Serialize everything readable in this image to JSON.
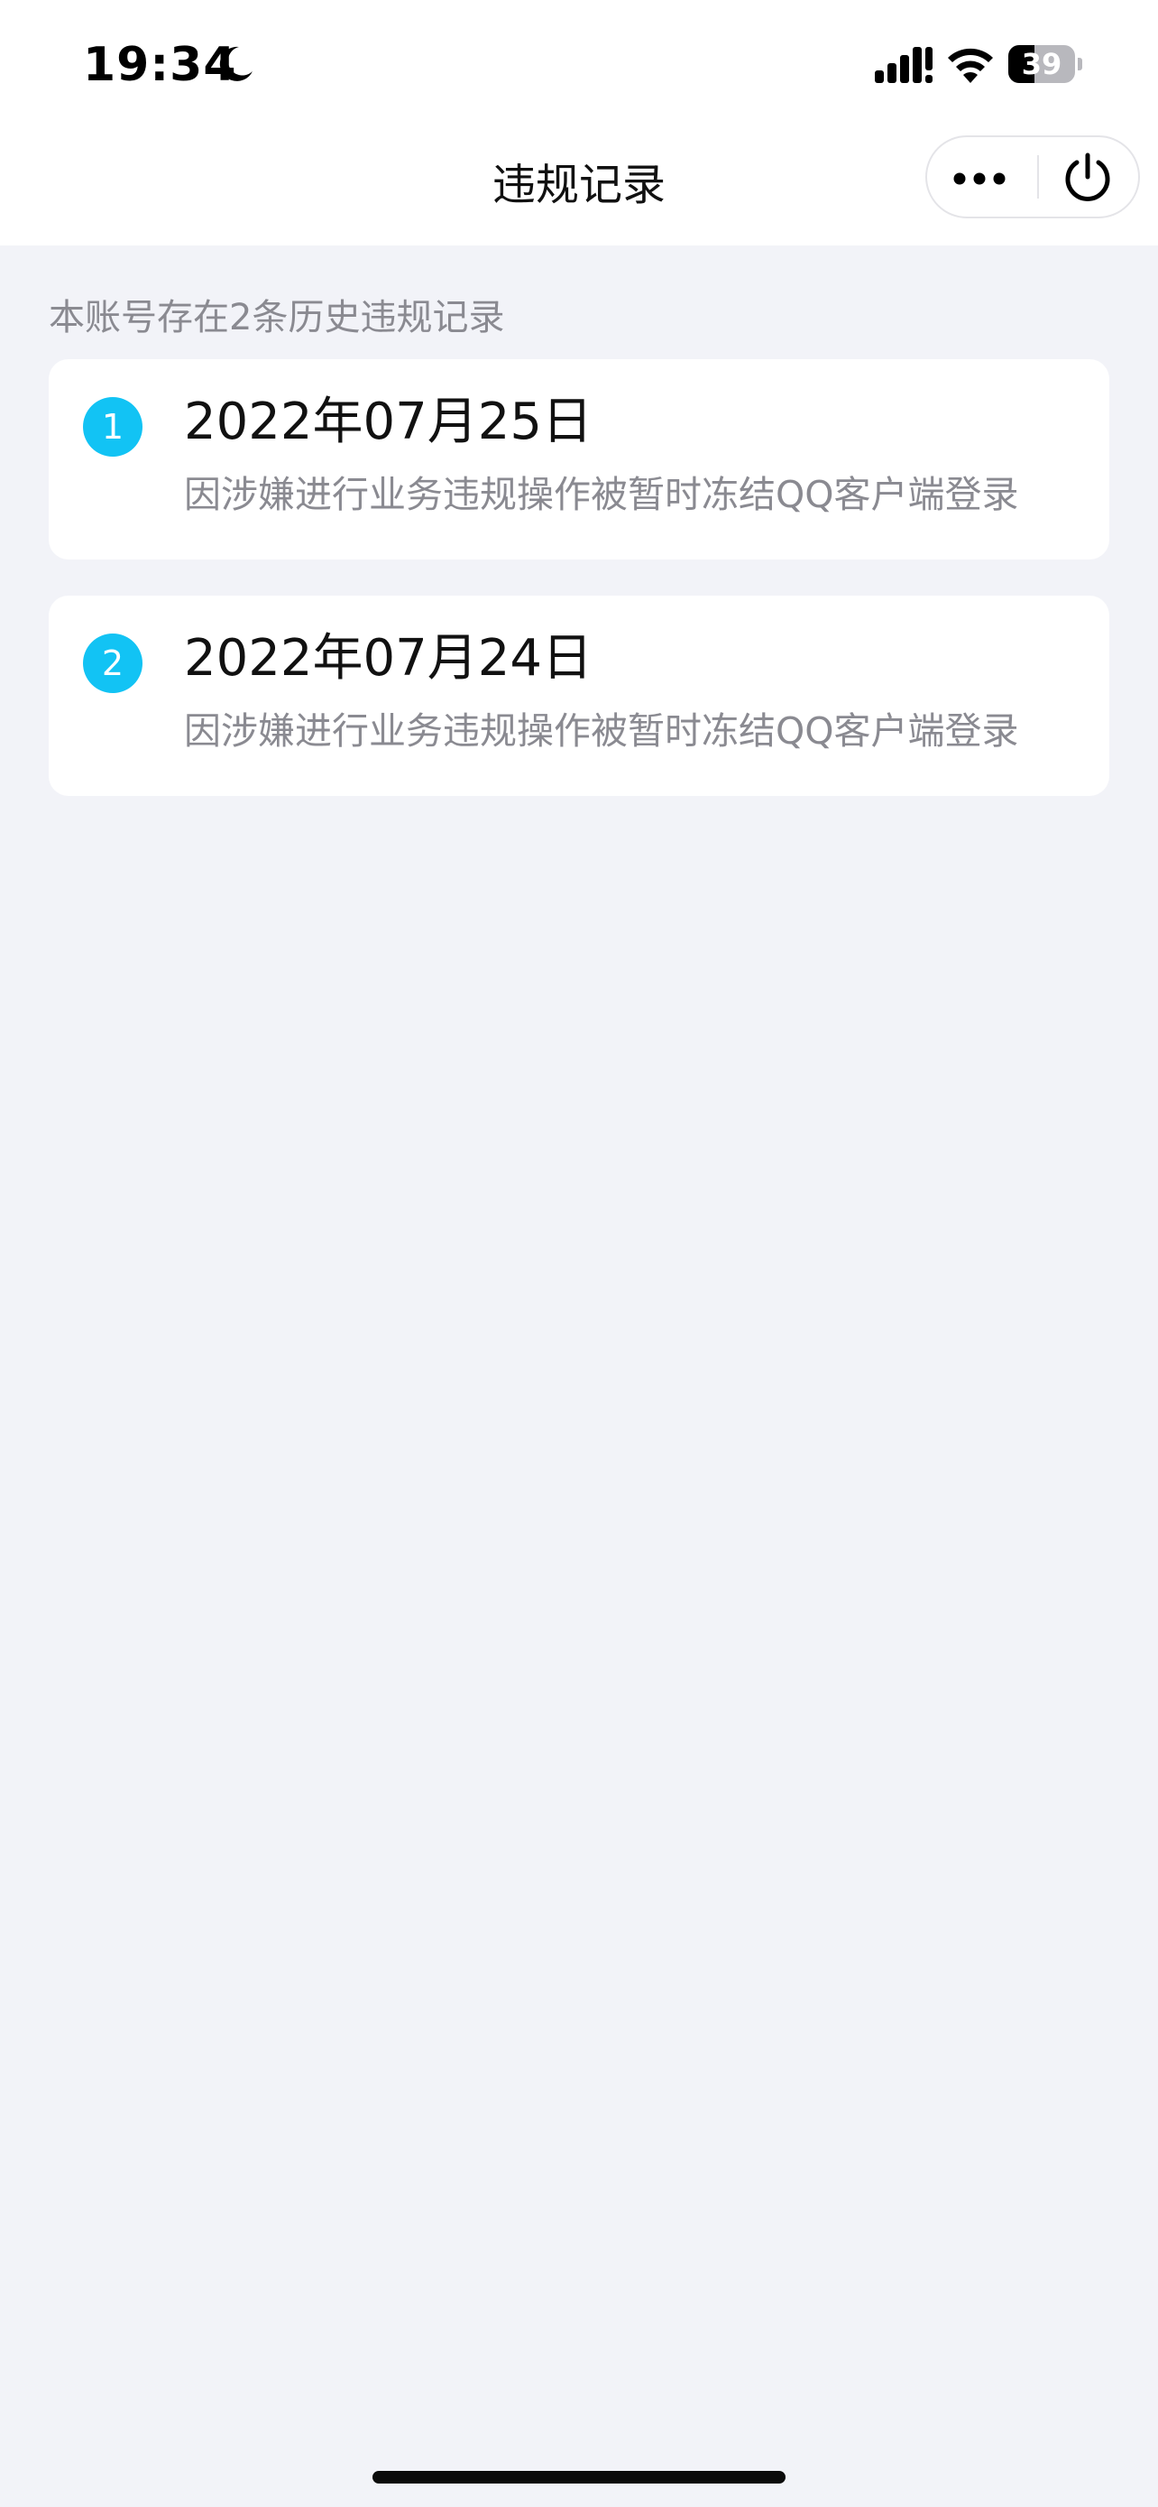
{
  "status_bar": {
    "time": "19:34",
    "battery_percent": "39",
    "battery_level": 0.39,
    "icons": [
      "moon-icon",
      "cellular-signal-icon",
      "wifi-icon",
      "battery-icon"
    ]
  },
  "nav": {
    "title": "违规记录",
    "more_icon": "ellipsis-icon",
    "close_icon": "power-icon"
  },
  "summary": "本账号存在2条历史违规记录",
  "records": [
    {
      "index": "1",
      "date": "2022年07月25日",
      "reason": "因涉嫌进行业务违规操作被暂时冻结QQ客户端登录"
    },
    {
      "index": "2",
      "date": "2022年07月24日",
      "reason": "因涉嫌进行业务违规操作被暂时冻结QQ客户端登录"
    }
  ],
  "colors": {
    "accent": "#12c3f4",
    "page_background": "#f2f3f8",
    "card_background": "#ffffff",
    "secondary_text": "#8a8a91"
  }
}
